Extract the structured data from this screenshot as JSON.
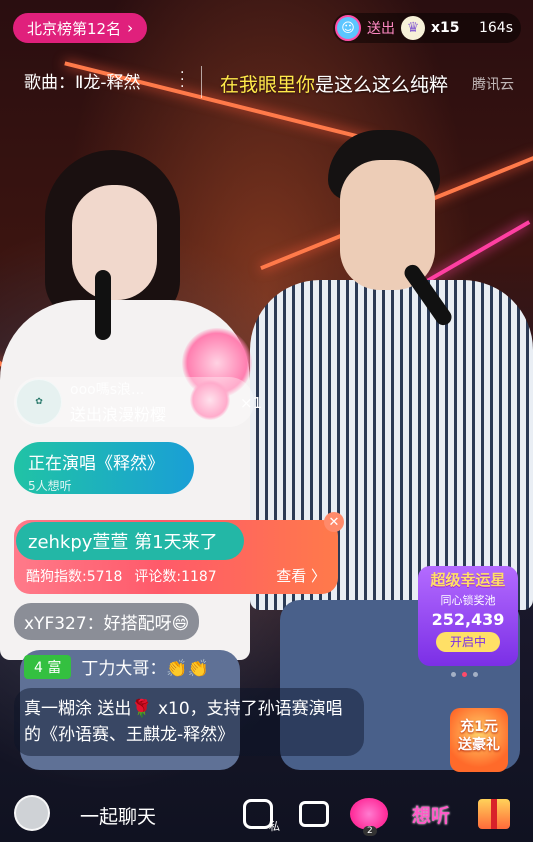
{
  "top": {
    "rank_label": "北京榜第12名",
    "rank_chevron": "chevron-right",
    "gift_label": "送出",
    "gift_count": "x15",
    "gift_timer": "164s"
  },
  "song": {
    "label": "歌曲：",
    "name": "Ⅱ龙-释然",
    "lyric_highlight": "在我眼里你",
    "lyric_rest": "是这么这么纯粹",
    "lyric_source": "腾讯云"
  },
  "gift_notice": {
    "name": "ooo嗎s浪...",
    "desc": "送出浪漫粉樱",
    "times": "×1"
  },
  "now_singing": {
    "title": "正在演唱《释然》",
    "subtitle": "5人想听"
  },
  "welcome": {
    "text": "zehkpy萱萱 第1天来了",
    "stats_a": "酷狗指数:5718",
    "stats_b": "评论数:1187",
    "view": "查看 〉"
  },
  "chat": [
    {
      "text": "xYF327：好搭配呀😄"
    },
    {
      "badge": "4 富",
      "text": "丁力大哥：👏👏"
    },
    {
      "text_a": "真一糊涂 送出",
      "rose": "🌹",
      "text_b": " x10，支持了孙语赛演唱的《孙语赛、王麒龙-释然》"
    }
  ],
  "lucky": {
    "title": "超级幸运星",
    "subtitle": "同心锁奖池",
    "value": "252,439",
    "button": "开启中"
  },
  "recharge": {
    "line1": "充1元",
    "line2": "送豪礼"
  },
  "bottom": {
    "chat_entry": "一起聊天",
    "private_label": "私",
    "heart_count": "2",
    "xiangting": "想听"
  },
  "colors": {
    "rank_pill": "#e0207c",
    "now_singing_start": "#20c3a5",
    "welcome_tag": "#23b7a6",
    "lucky": "#7b2fe6",
    "lyric_highlight": "#ffe94a"
  }
}
